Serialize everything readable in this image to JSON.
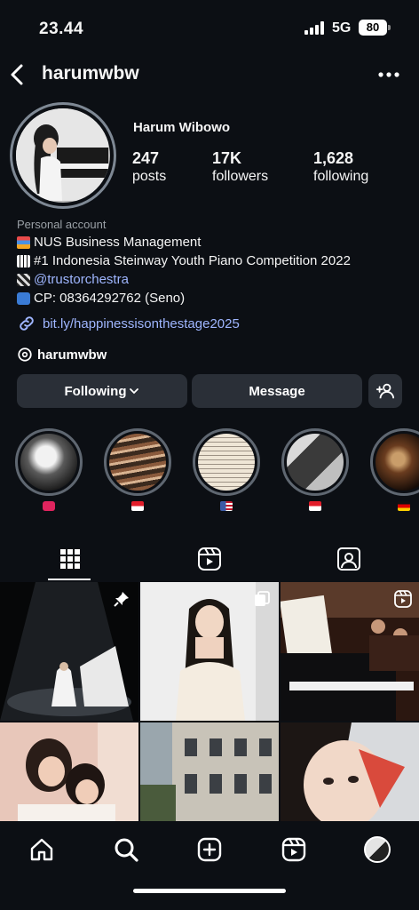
{
  "status_bar": {
    "time": "23.44",
    "network": "5G",
    "battery": "80"
  },
  "header": {
    "username": "harumwbw",
    "back_icon": "chevron-left-icon",
    "more_icon": "ellipsis-icon"
  },
  "profile": {
    "display_name": "Harum Wibowo",
    "stats": [
      {
        "value": "247",
        "label": "posts"
      },
      {
        "value": "17K",
        "label": "followers"
      },
      {
        "value": "1,628",
        "label": "following"
      }
    ],
    "category": "Personal account",
    "bio_lines": [
      {
        "icon": "books-emoji",
        "text": "NUS Business Management"
      },
      {
        "icon": "piano-keys-emoji",
        "text": "#1 Indonesia Steinway Youth Piano Competition 2022"
      },
      {
        "icon": "clapper-emoji",
        "text": "@trustorchestra"
      },
      {
        "icon": "phone-emoji",
        "text": "CP: 08364292762 (Seno)"
      }
    ],
    "link": "bit.ly/happinessisonthestage2025",
    "threads_handle": "harumwbw"
  },
  "actions": {
    "following": "Following",
    "message": "Message"
  },
  "highlights": [
    {
      "icon": "heart-emoji",
      "color": "#e0245e"
    },
    {
      "icon": "indonesia-flag-icon",
      "color": "#e11d2a"
    },
    {
      "icon": "usa-flag-icon",
      "color": "#3c5aa6"
    },
    {
      "icon": "indonesia-flag-icon",
      "color": "#e11d2a"
    },
    {
      "icon": "germany-flag-icon",
      "color": "#d00000"
    }
  ],
  "tabs": [
    {
      "name": "posts-grid",
      "icon": "grid-icon",
      "active": true
    },
    {
      "name": "reels",
      "icon": "reels-icon",
      "active": false
    },
    {
      "name": "tagged",
      "icon": "tagged-icon",
      "active": false
    }
  ],
  "grid": [
    {
      "desc": "pianist on stage",
      "badge": "pin-icon"
    },
    {
      "desc": "portrait in white dress",
      "badge": "carousel-icon"
    },
    {
      "desc": "orchestra with piano",
      "badge": "reel-icon"
    },
    {
      "desc": "two friends smiling",
      "badge": ""
    },
    {
      "desc": "classical building",
      "badge": ""
    },
    {
      "desc": "selfie with red leaf",
      "badge": ""
    }
  ],
  "nav": [
    "home-icon",
    "search-icon",
    "create-icon",
    "reels-icon",
    "profile-avatar"
  ],
  "colors": {
    "background": "#0c0f14",
    "button": "#2a2f37",
    "link": "#9fb6ff",
    "muted": "#9aa0a6"
  }
}
